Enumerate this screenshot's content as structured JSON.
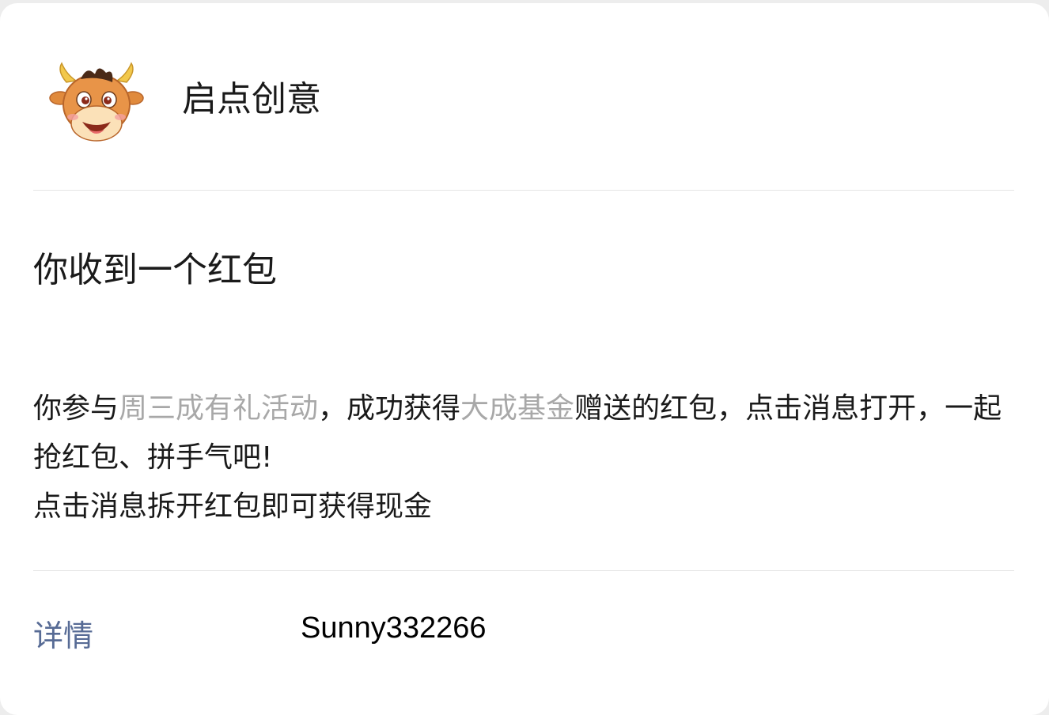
{
  "header": {
    "account_name": "启点创意",
    "avatar_icon": "cartoon-bull-avatar"
  },
  "message": {
    "title": "你收到一个红包",
    "body": {
      "p1": "你参与",
      "event_name": "周三成有礼活动",
      "p2": "，成功获得",
      "sponsor": "大成基金",
      "p3": "赠送的红包，点击消息打开，一起抢红包、拼手气吧!",
      "line2": "点击消息拆开红包即可获得现金"
    }
  },
  "footer": {
    "details_label": "详情",
    "username": "Sunny332266"
  },
  "colors": {
    "link": "#576b95",
    "highlight": "#a8a8a8",
    "text": "#1a1a1a"
  }
}
